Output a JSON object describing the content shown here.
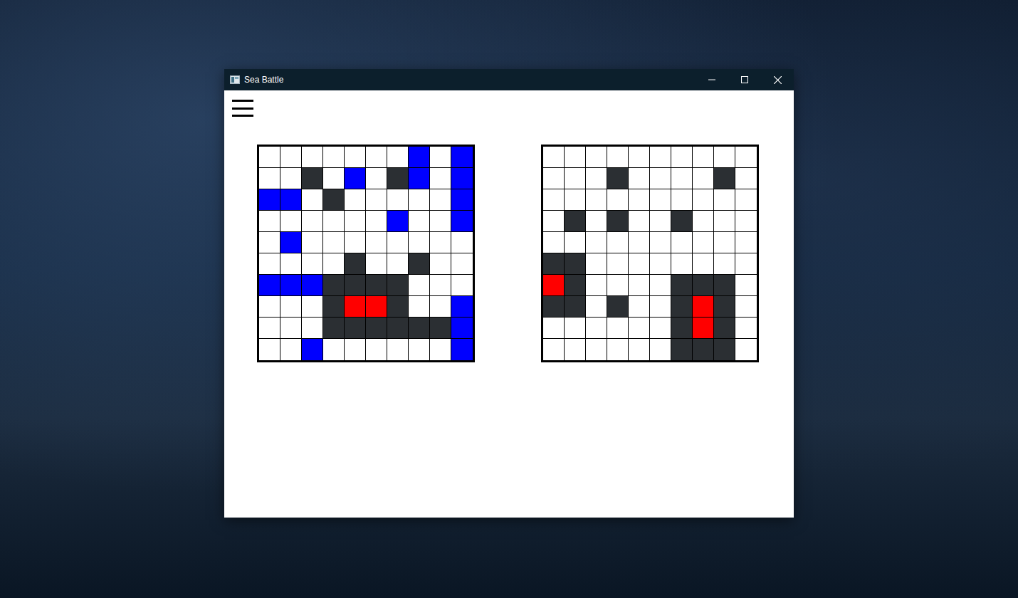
{
  "window": {
    "title": "Sea Battle"
  },
  "boards": [
    {
      "name": "player",
      "rows": [
        [
          "empty",
          "empty",
          "empty",
          "empty",
          "empty",
          "empty",
          "empty",
          "ship",
          "empty",
          "ship"
        ],
        [
          "empty",
          "empty",
          "miss",
          "empty",
          "ship",
          "empty",
          "miss",
          "ship",
          "empty",
          "ship"
        ],
        [
          "ship",
          "ship",
          "empty",
          "miss",
          "empty",
          "empty",
          "empty",
          "empty",
          "empty",
          "ship"
        ],
        [
          "empty",
          "empty",
          "empty",
          "empty",
          "empty",
          "empty",
          "ship",
          "empty",
          "empty",
          "ship"
        ],
        [
          "empty",
          "ship",
          "empty",
          "empty",
          "empty",
          "empty",
          "empty",
          "empty",
          "empty",
          "empty"
        ],
        [
          "empty",
          "empty",
          "empty",
          "empty",
          "miss",
          "empty",
          "empty",
          "miss",
          "empty",
          "empty"
        ],
        [
          "ship",
          "ship",
          "ship",
          "miss",
          "miss",
          "miss",
          "miss",
          "empty",
          "empty",
          "empty"
        ],
        [
          "empty",
          "empty",
          "empty",
          "miss",
          "hit",
          "hit",
          "miss",
          "empty",
          "empty",
          "ship"
        ],
        [
          "empty",
          "empty",
          "empty",
          "miss",
          "miss",
          "miss",
          "miss",
          "miss",
          "miss",
          "ship"
        ],
        [
          "empty",
          "empty",
          "ship",
          "empty",
          "empty",
          "empty",
          "empty",
          "empty",
          "empty",
          "ship"
        ]
      ]
    },
    {
      "name": "enemy",
      "rows": [
        [
          "empty",
          "empty",
          "empty",
          "empty",
          "empty",
          "empty",
          "empty",
          "empty",
          "empty",
          "empty"
        ],
        [
          "empty",
          "empty",
          "empty",
          "miss",
          "empty",
          "empty",
          "empty",
          "empty",
          "miss",
          "empty"
        ],
        [
          "empty",
          "empty",
          "empty",
          "empty",
          "empty",
          "empty",
          "empty",
          "empty",
          "empty",
          "empty"
        ],
        [
          "empty",
          "miss",
          "empty",
          "miss",
          "empty",
          "empty",
          "miss",
          "empty",
          "empty",
          "empty"
        ],
        [
          "empty",
          "empty",
          "empty",
          "empty",
          "empty",
          "empty",
          "empty",
          "empty",
          "empty",
          "empty"
        ],
        [
          "miss",
          "miss",
          "empty",
          "empty",
          "empty",
          "empty",
          "empty",
          "empty",
          "empty",
          "empty"
        ],
        [
          "hit",
          "miss",
          "empty",
          "empty",
          "empty",
          "empty",
          "miss",
          "miss",
          "miss",
          "empty"
        ],
        [
          "miss",
          "miss",
          "empty",
          "miss",
          "empty",
          "empty",
          "miss",
          "hit",
          "miss",
          "empty"
        ],
        [
          "empty",
          "empty",
          "empty",
          "empty",
          "empty",
          "empty",
          "miss",
          "hit",
          "miss",
          "empty"
        ],
        [
          "empty",
          "empty",
          "empty",
          "empty",
          "empty",
          "empty",
          "miss",
          "miss",
          "miss",
          "empty"
        ]
      ]
    }
  ]
}
